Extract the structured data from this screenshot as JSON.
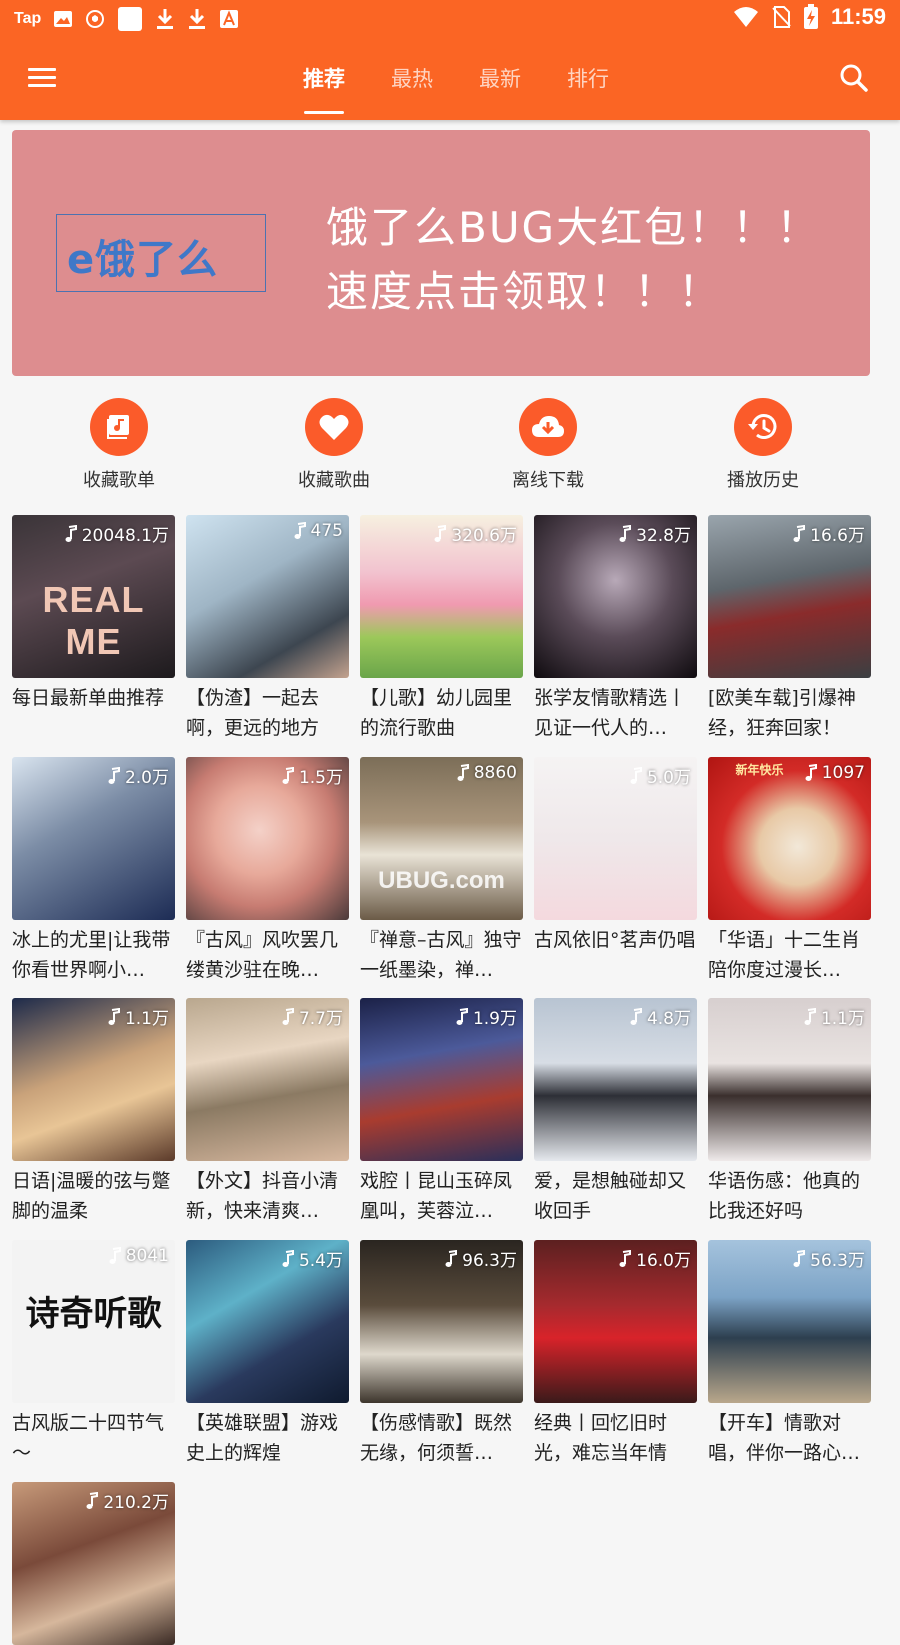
{
  "status_bar": {
    "carrier": "Tap",
    "time": "11:59",
    "icons": [
      "image-icon",
      "shield-icon",
      "square-icon",
      "download-icon",
      "download-icon",
      "font-icon",
      "wifi-icon",
      "no-sim-icon",
      "battery-charging-icon"
    ]
  },
  "toolbar": {
    "menu_icon": "hamburger-icon",
    "search_icon": "search-icon",
    "tabs": [
      {
        "label": "推荐",
        "active": true
      },
      {
        "label": "最热",
        "active": false
      },
      {
        "label": "最新",
        "active": false
      },
      {
        "label": "排行",
        "active": false
      }
    ]
  },
  "banner": {
    "logo_text": "e饿了么",
    "line1": "饿了么BUG大红包！！！",
    "line2": "速度点击领取！！！",
    "background": "#dd8d8f"
  },
  "quick_actions": [
    {
      "label": "收藏歌单",
      "icon": "playlist-icon"
    },
    {
      "label": "收藏歌曲",
      "icon": "heart-icon"
    },
    {
      "label": "离线下载",
      "icon": "cloud-download-icon"
    },
    {
      "label": "播放历史",
      "icon": "history-icon"
    }
  ],
  "playlists": [
    {
      "count": "20048.1万",
      "title": "每日最新单曲推荐",
      "cover_text": "REAL ME"
    },
    {
      "count": "475",
      "title": "【伪渣】一起去啊，更远的地方",
      "cover_text": ""
    },
    {
      "count": "320.6万",
      "title": "【儿歌】幼儿园里的流行歌曲",
      "cover_text": ""
    },
    {
      "count": "32.8万",
      "title": "张学友情歌精选丨见证一代人的…",
      "cover_text": ""
    },
    {
      "count": "16.6万",
      "title": "[欧美车载]引爆神经，狂奔回家！",
      "cover_text": ""
    },
    {
      "count": "2.0万",
      "title": "冰上的尤里|让我带你看世界啊小…",
      "cover_text": ""
    },
    {
      "count": "1.5万",
      "title": "『古风』风吹罢几缕黄沙驻在晚…",
      "cover_text": ""
    },
    {
      "count": "8860",
      "title": "『禅意–古风』独守一纸墨染，禅…",
      "cover_text": "UBUG.com"
    },
    {
      "count": "5.0万",
      "title": "古风依旧°茗声仍唱",
      "cover_text": ""
    },
    {
      "count": "1097",
      "title": "「华语」十二生肖陪你度过漫长…",
      "cover_text": "新年快乐"
    },
    {
      "count": "1.1万",
      "title": "日语|温暖的弦与蹩脚的温柔",
      "cover_text": ""
    },
    {
      "count": "7.7万",
      "title": "【外文】抖音小清新，快来清爽…",
      "cover_text": ""
    },
    {
      "count": "1.9万",
      "title": "戏腔丨昆山玉碎凤凰叫，芙蓉泣…",
      "cover_text": ""
    },
    {
      "count": "4.8万",
      "title": "爱，是想触碰却又收回手",
      "cover_text": ""
    },
    {
      "count": "1.1万",
      "title": "华语伤感：他真的比我还好吗",
      "cover_text": ""
    },
    {
      "count": "8041",
      "title": "古风版二十四节气～",
      "cover_text": "诗奇听歌"
    },
    {
      "count": "5.4万",
      "title": "【英雄联盟】游戏史上的辉煌",
      "cover_text": ""
    },
    {
      "count": "96.3万",
      "title": "【伤感情歌】既然无缘，何须誓…",
      "cover_text": ""
    },
    {
      "count": "16.0万",
      "title": "经典丨回忆旧时光，难忘当年情",
      "cover_text": ""
    },
    {
      "count": "56.3万",
      "title": "【开车】情歌对唱，伴你一路心…",
      "cover_text": ""
    },
    {
      "count": "210.2万",
      "title": "",
      "cover_text": ""
    }
  ],
  "colors": {
    "primary": "#fb6524",
    "accent": "#fb5b2a",
    "background": "#f6f6f6"
  }
}
